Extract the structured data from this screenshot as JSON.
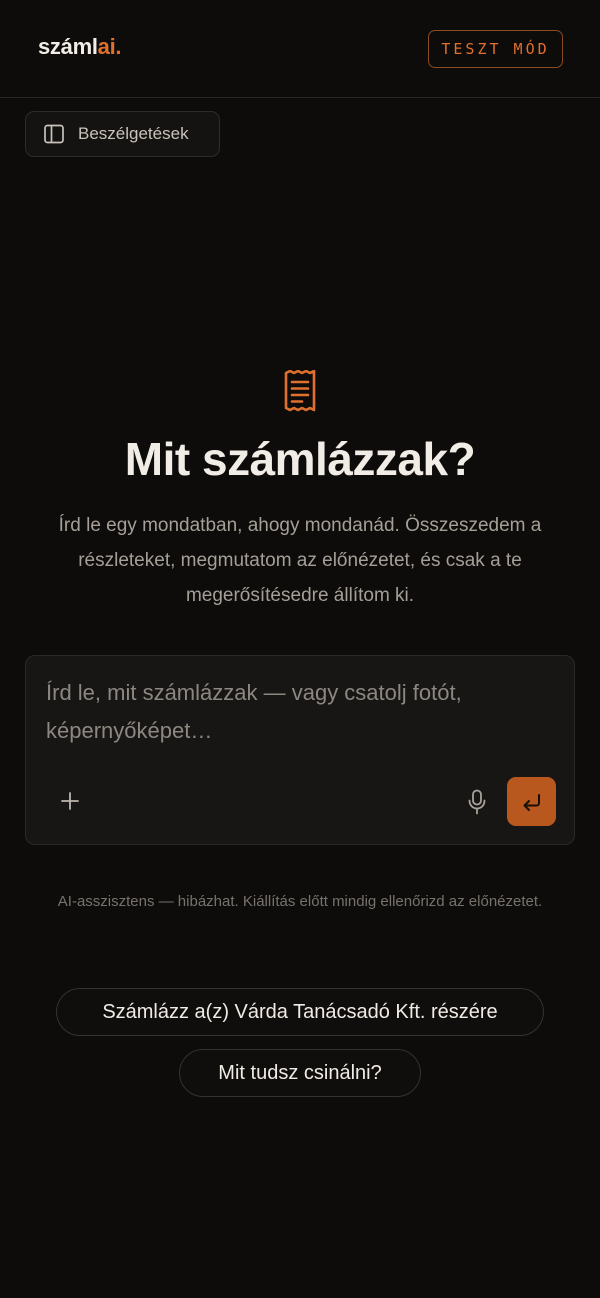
{
  "header": {
    "logo_main": "száml",
    "logo_accent": "ai.",
    "test_mode_label": "TESZT MÓD"
  },
  "sidebar_toggle": {
    "label": "Beszélgetések",
    "icon": "sidebar-panel-icon"
  },
  "hero": {
    "icon": "receipt-icon",
    "title": "Mit számlázzak?",
    "subtitle": "Írd le egy mondatban, ahogy mondanád. Összeszedem a részleteket, megmutatom az előnézetet, és csak a te megerősítésedre állítom ki."
  },
  "composer": {
    "placeholder": "Írd le, mit számlázzak — vagy csatolj fotót, képernyőképet…",
    "value": "",
    "attach_icon": "plus-icon",
    "mic_icon": "microphone-icon",
    "send_icon": "enter-arrow-icon"
  },
  "disclaimer": "AI-asszisztens — hibázhat. Kiállítás előtt mindig ellenőrizd az előnézetet.",
  "suggestions": [
    "Számlázz a(z) Várda Tanácsadó Kft. részére",
    "Mit tudsz csinálni?"
  ],
  "colors": {
    "background": "#0d0c0b",
    "accent": "#e0702e",
    "send_button": "#b8581f"
  }
}
